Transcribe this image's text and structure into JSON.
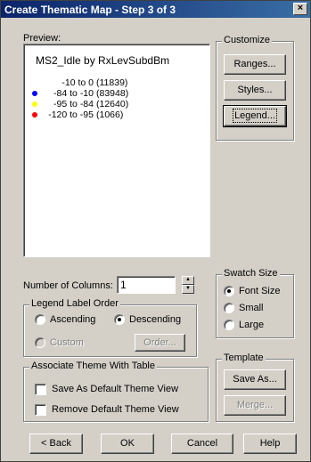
{
  "window": {
    "title": "Create Thematic Map - Step 3 of 3",
    "close_glyph": "×"
  },
  "preview": {
    "label": "Preview:",
    "map_title": "MS2_Idle by RxLevSubdBm",
    "legend": [
      {
        "range": "-10 to   0",
        "count": "(11839)",
        "color": ""
      },
      {
        "range": "-84 to -10",
        "count": "(83948)",
        "color": "#0000ff"
      },
      {
        "range": "-95 to -84",
        "count": "(12640)",
        "color": "#ffff00"
      },
      {
        "range": "-120 to -95",
        "count": "(1066)",
        "color": "#ff0000"
      }
    ]
  },
  "customize": {
    "title": "Customize",
    "ranges_label": "Ranges...",
    "styles_label": "Styles...",
    "legend_label": "Legend..."
  },
  "columns": {
    "label": "Number of Columns:",
    "value": "1"
  },
  "label_order": {
    "title": "Legend Label Order",
    "ascending": "Ascending",
    "descending": "Descending",
    "custom": "Custom",
    "order_button": "Order..."
  },
  "swatch": {
    "title": "Swatch Size",
    "font_size": "Font Size",
    "small": "Small",
    "large": "Large"
  },
  "associate": {
    "title": "Associate Theme With Table",
    "save_default": "Save As Default Theme View",
    "remove_default": "Remove Default Theme View"
  },
  "template": {
    "title": "Template",
    "save_as": "Save As...",
    "merge": "Merge..."
  },
  "footer": {
    "back": "< Back",
    "ok": "OK",
    "cancel": "Cancel",
    "help": "Help"
  }
}
